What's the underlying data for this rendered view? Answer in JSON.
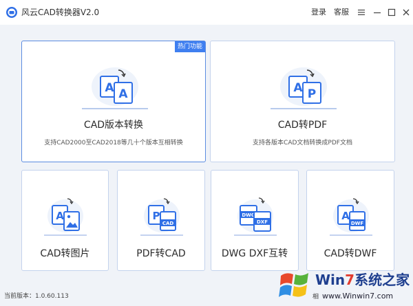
{
  "app": {
    "title": "风云CAD转换器V2.0",
    "login_label": "登录",
    "service_label": "客服"
  },
  "cards": {
    "cad_version": {
      "title": "CAD版本转换",
      "desc": "支持CAD2000至CAD2018等几十个版本互相转换",
      "badge": "热门功能"
    },
    "cad_pdf": {
      "title": "CAD转PDF",
      "desc": "支持各版本CAD文档转换成PDF文档"
    },
    "cad_image": {
      "title": "CAD转图片"
    },
    "pdf_cad": {
      "title": "PDF转CAD",
      "tag": "CAD"
    },
    "dwg_dxf": {
      "title": "DWG DXF互转",
      "tag1": "DWG",
      "tag2": "DXF"
    },
    "cad_dwf": {
      "title": "CAD转DWF",
      "tag": "DWF"
    }
  },
  "icons": {
    "doc_letter_a": "A",
    "doc_letter_p": "P"
  },
  "status": {
    "version": "当前版本：1.0.60.113"
  },
  "watermark": {
    "brand_win": "Win",
    "brand_7": "7",
    "brand_cn": "系统之家",
    "url": "www.Winwin7.com",
    "partial_text": "相"
  },
  "colors": {
    "accent": "#3f7ff0",
    "card_border": "#c3d2ec",
    "icon_blue": "#2f6fe6"
  }
}
